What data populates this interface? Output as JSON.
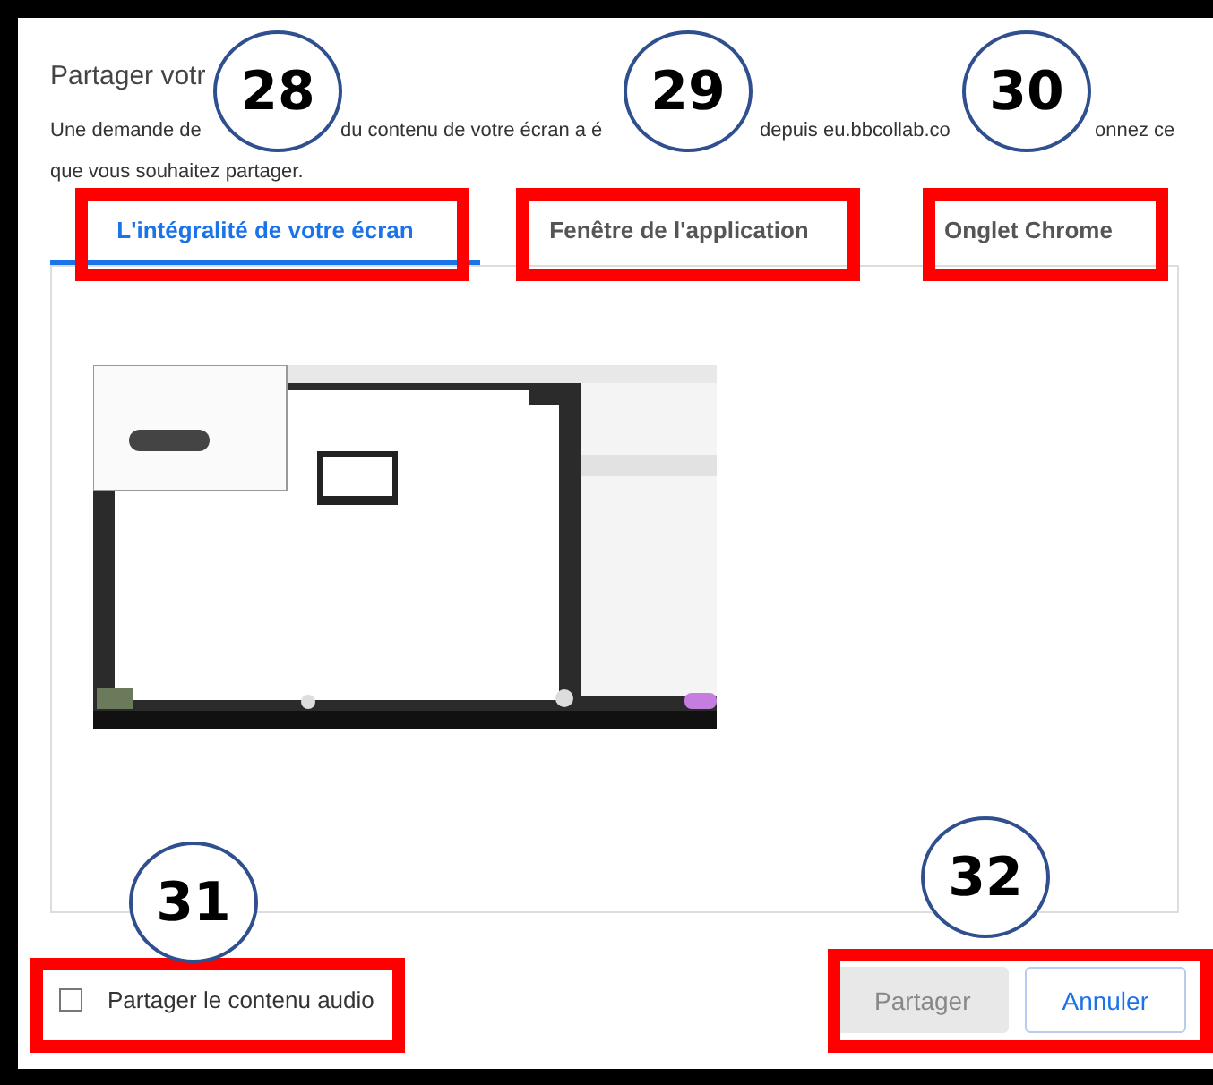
{
  "dialog": {
    "title": "Partager votr",
    "description_lines": [
      [
        "Une demande de",
        "du contenu de votre écran a é",
        "depuis eu.bbcollab.co",
        "onnez ce"
      ],
      [
        "que vous souhaitez partager."
      ]
    ]
  },
  "tabs": [
    {
      "label": "L'intégralité de votre écran",
      "selected": true
    },
    {
      "label": "Fenêtre de l'application",
      "selected": false
    },
    {
      "label": "Onglet Chrome",
      "selected": false
    }
  ],
  "audio_option": {
    "label": "Partager le contenu audio",
    "checked": false
  },
  "buttons": [
    {
      "label": "Partager",
      "disabled": true
    },
    {
      "label": "Annuler",
      "disabled": false
    }
  ],
  "annotations": [
    {
      "number": "28"
    },
    {
      "number": "29"
    },
    {
      "number": "30"
    },
    {
      "number": "31"
    },
    {
      "number": "32"
    }
  ]
}
